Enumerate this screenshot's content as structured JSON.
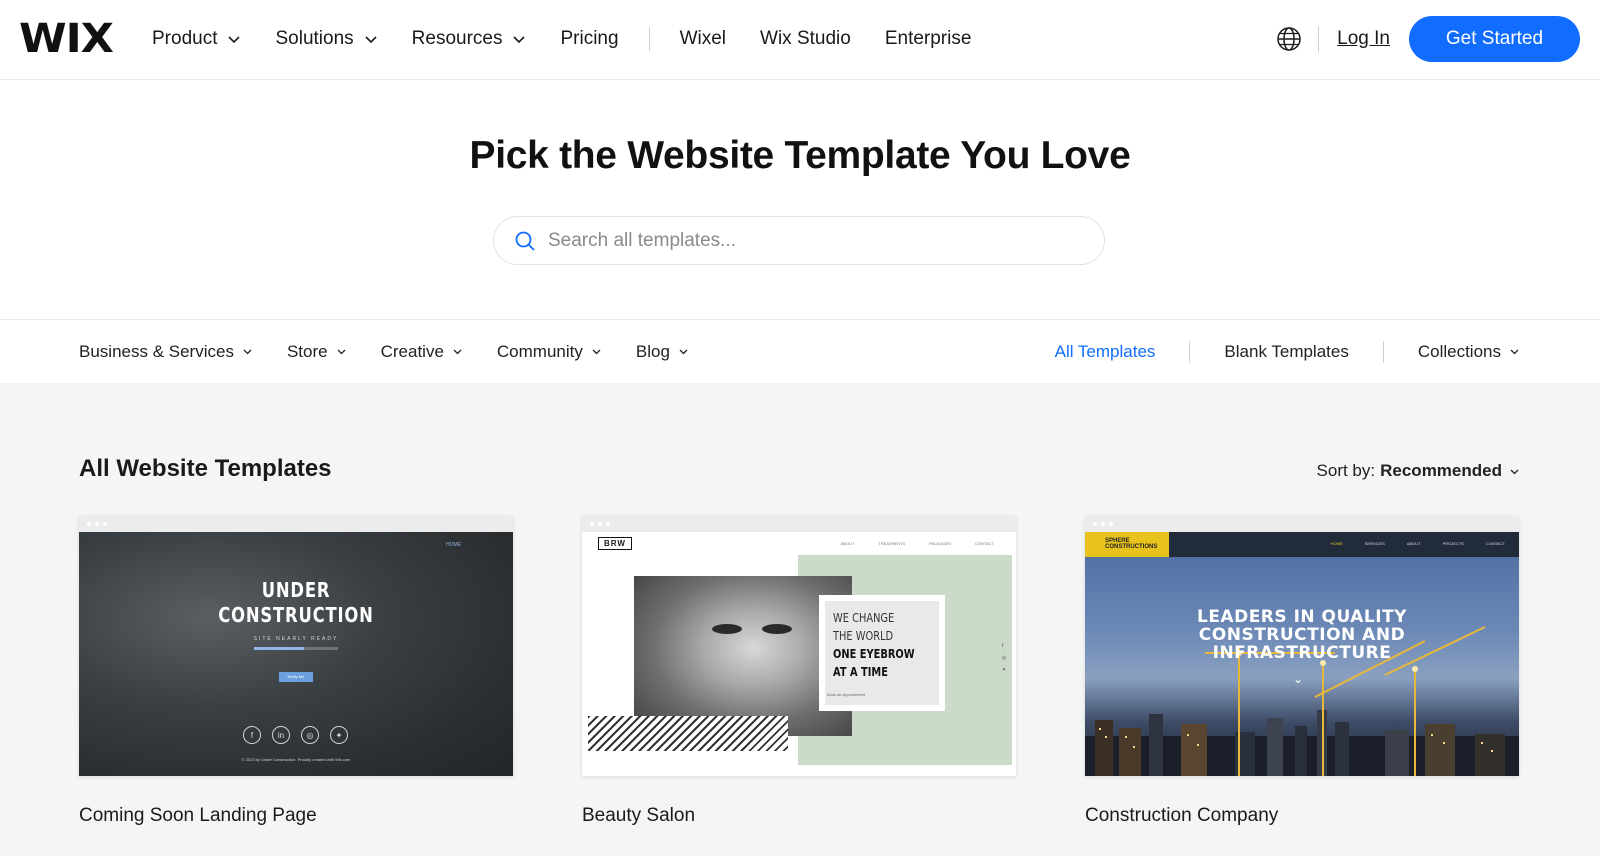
{
  "header": {
    "logo": "WIX",
    "nav": [
      {
        "label": "Product",
        "dropdown": true
      },
      {
        "label": "Solutions",
        "dropdown": true
      },
      {
        "label": "Resources",
        "dropdown": true
      },
      {
        "label": "Pricing",
        "dropdown": false
      }
    ],
    "nav_secondary": [
      "Wixel",
      "Wix Studio",
      "Enterprise"
    ],
    "login": "Log In",
    "cta": "Get Started",
    "accent": "#116dff"
  },
  "hero": {
    "title": "Pick the Website Template You Love",
    "search_placeholder": "Search all templates..."
  },
  "categories": {
    "items": [
      "Business & Services",
      "Store",
      "Creative",
      "Community",
      "Blog"
    ],
    "all_templates": "All Templates",
    "blank_templates": "Blank Templates",
    "collections": "Collections"
  },
  "gallery": {
    "title": "All Website Templates",
    "sort_label": "Sort by:",
    "sort_value": "Recommended",
    "cards": [
      {
        "name": "Coming Soon Landing Page",
        "thumb": {
          "nav": "HOME",
          "title_1": "UNDER",
          "title_2": "CONSTRUCTION",
          "subtitle": "SITE NEARLY READY",
          "button": "Notify Me",
          "footer": "© 2023 by Under Construction. Proudly created with Wix.com"
        }
      },
      {
        "name": "Beauty Salon",
        "thumb": {
          "logo": "BRW",
          "nav": [
            "ABOUT",
            "TREATMENTS",
            "PACKAGES",
            "CONTACT"
          ],
          "line_1": "WE CHANGE",
          "line_2": "THE WORLD",
          "line_3": "ONE EYEBROW",
          "line_4": "AT A TIME",
          "appt": "Book an Appointment"
        }
      },
      {
        "name": "Construction Company",
        "thumb": {
          "logo_1": "SPHERE",
          "logo_2": "CONSTRUCTIONS",
          "nav": [
            "HOME",
            "SERVICES",
            "ABOUT",
            "PROJECTS",
            "CONTACT"
          ],
          "title_1": "LEADERS IN QUALITY",
          "title_2": "CONSTRUCTION AND",
          "title_3": "INFRASTRUCTURE"
        }
      }
    ]
  }
}
